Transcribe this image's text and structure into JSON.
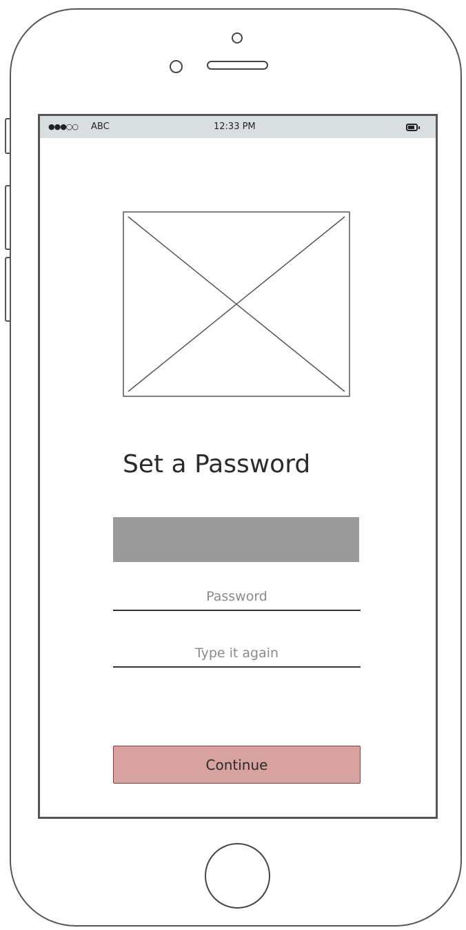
{
  "status_bar": {
    "signal": "●●●○○",
    "carrier": "ABC",
    "time": "12:33 PM",
    "battery_icon": "battery-icon"
  },
  "main": {
    "image_placeholder_icon": "image-placeholder",
    "title": "Set a Password",
    "password_field": {
      "placeholder": "Password",
      "value": ""
    },
    "confirm_field": {
      "placeholder": "Type it again",
      "value": ""
    },
    "continue_label": "Continue"
  },
  "colors": {
    "status_bar_bg": "#d9dfe1",
    "gray_block": "#9a9a9a",
    "button_fill": "#d8a2a1",
    "button_border": "#8e3b3a"
  }
}
